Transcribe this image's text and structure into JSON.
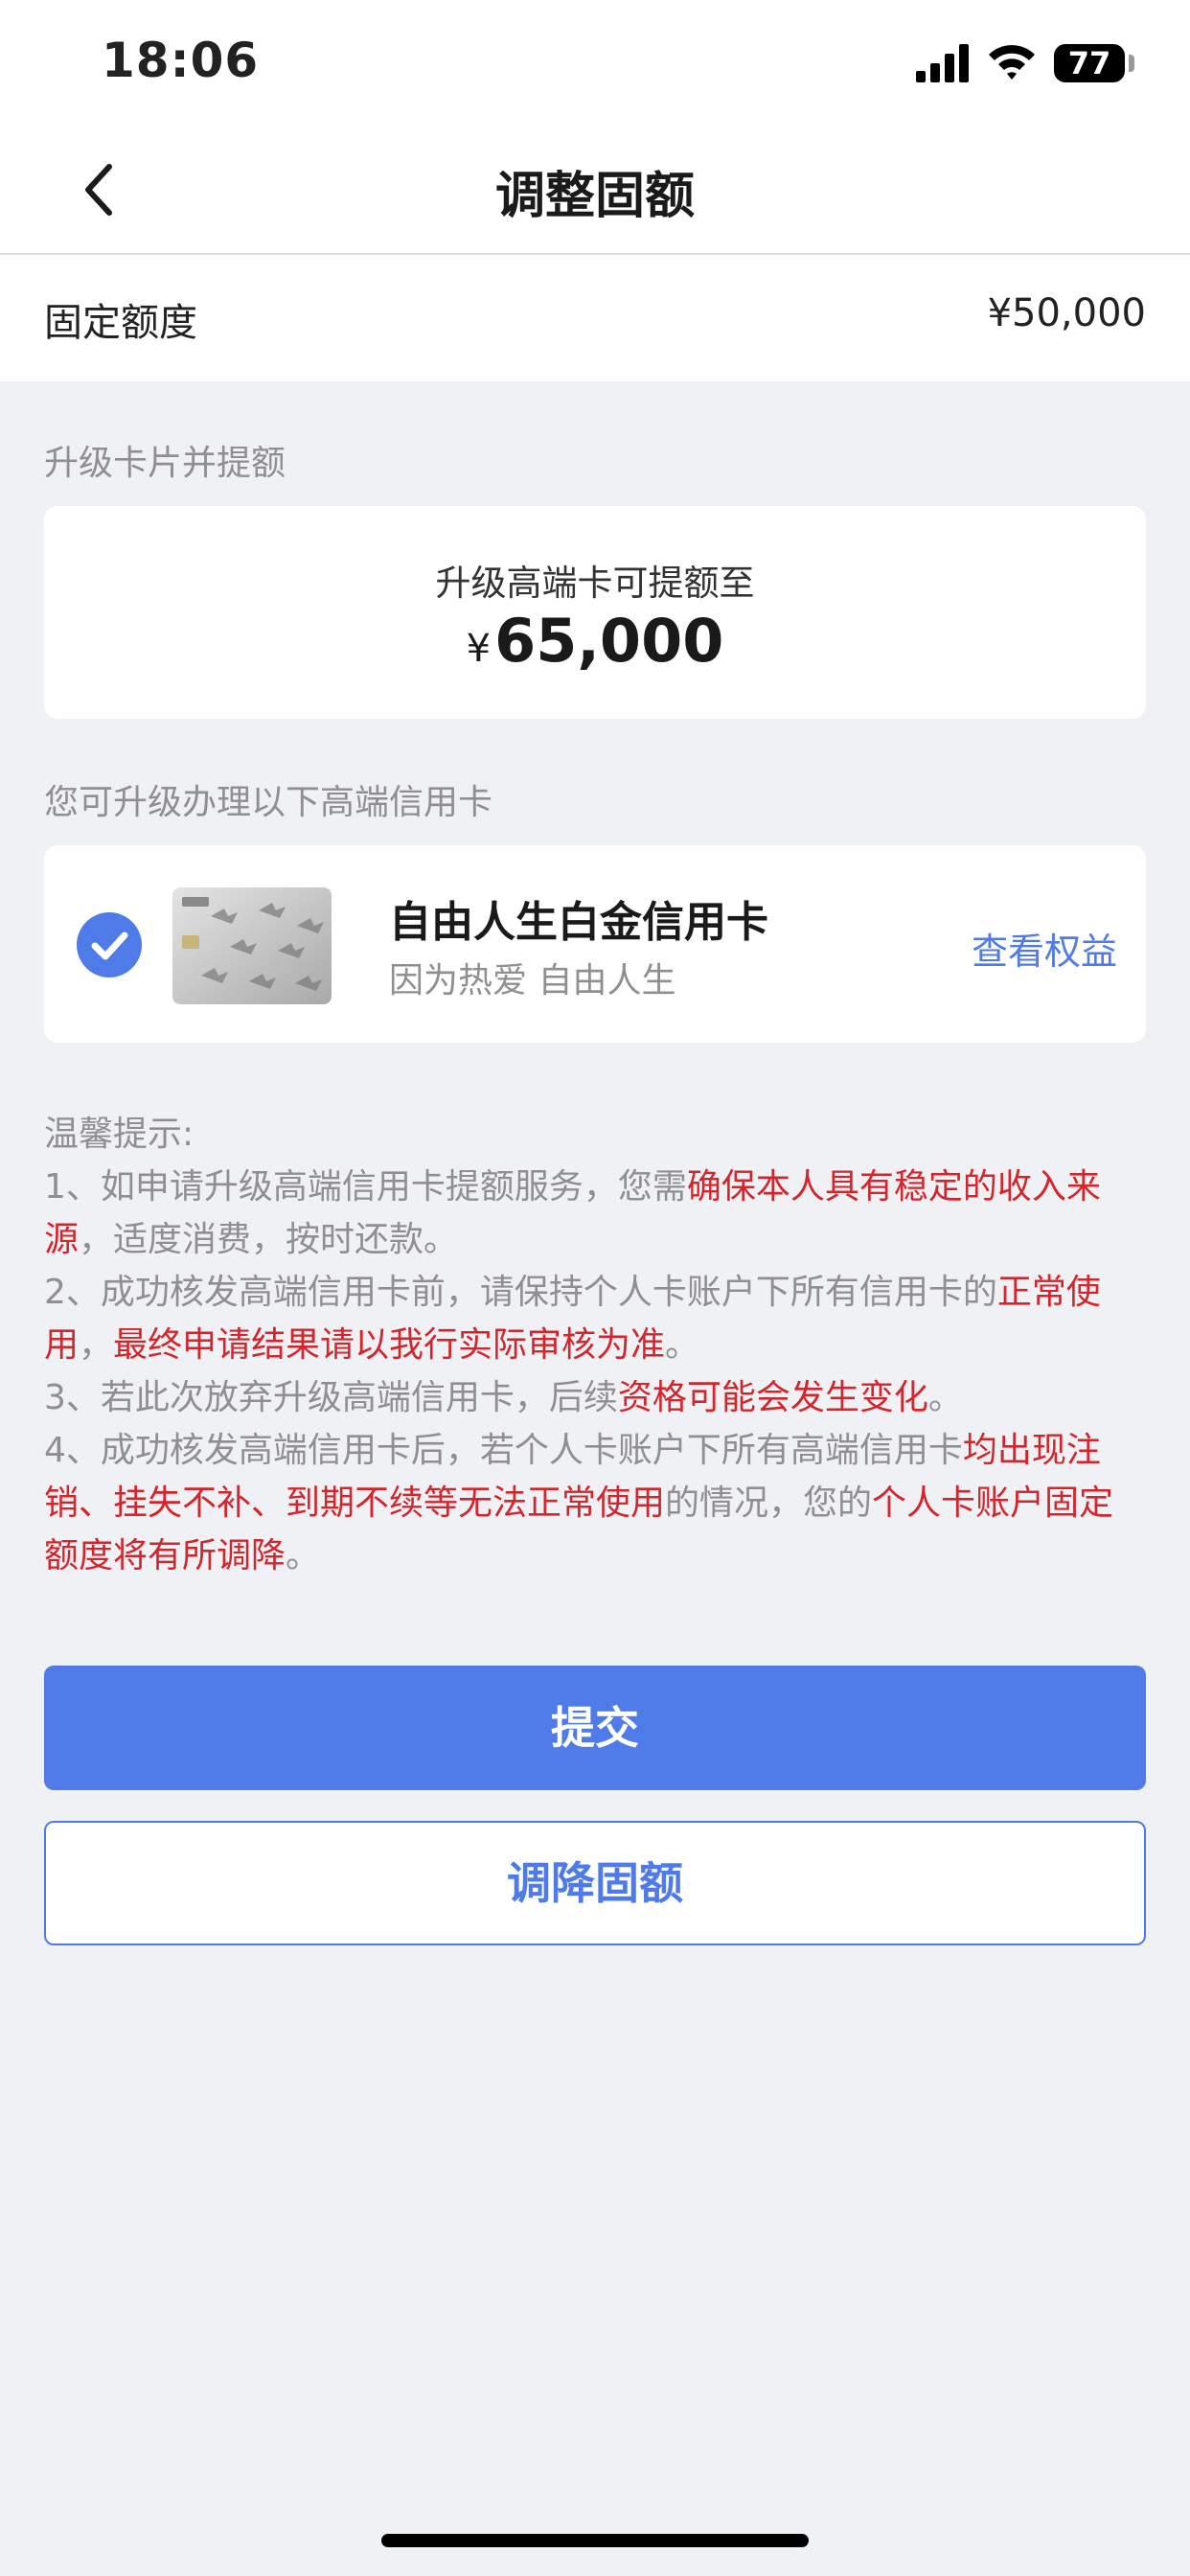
{
  "status_bar": {
    "time": "18:06",
    "battery": "77",
    "icons": [
      "signal-icon",
      "wifi-icon",
      "battery-icon"
    ]
  },
  "nav": {
    "title": "调整固额",
    "back_icon": "chevron-left-icon"
  },
  "fixed_limit": {
    "label": "固定额度",
    "value": "¥50,000"
  },
  "upgrade_section": {
    "label": "升级卡片并提额",
    "sub": "升级高端卡可提额至",
    "currency": "¥",
    "amount": "65,000"
  },
  "card_section": {
    "label": "您可升级办理以下高端信用卡",
    "card": {
      "name": "自由人生白金信用卡",
      "slogan": "因为热爱 自由人生",
      "link": "查看权益",
      "selected": true
    }
  },
  "tips": {
    "title": "温馨提示:",
    "items": [
      [
        {
          "text": "1、如申请升级高端信用卡提额服务，您需",
          "highlight": false
        },
        {
          "text": "确保本人具有稳定的收入来源",
          "highlight": true
        },
        {
          "text": "，适度消费，按时还款。",
          "highlight": false
        }
      ],
      [
        {
          "text": "2、成功核发高端信用卡前，请保持个人卡账户下所有信用卡的",
          "highlight": false
        },
        {
          "text": "正常使用",
          "highlight": true
        },
        {
          "text": "，",
          "highlight": false
        },
        {
          "text": "最终申请结果请以我行实际审核为准",
          "highlight": true
        },
        {
          "text": "。",
          "highlight": false
        }
      ],
      [
        {
          "text": "3、若此次放弃升级高端信用卡，后续",
          "highlight": false
        },
        {
          "text": "资格可能会发生变化",
          "highlight": true
        },
        {
          "text": "。",
          "highlight": false
        }
      ],
      [
        {
          "text": "4、成功核发高端信用卡后，若个人卡账户下所有高端信用卡",
          "highlight": false
        },
        {
          "text": "均出现注销、挂失不补、到期不续等无法正常使用",
          "highlight": true
        },
        {
          "text": "的情况，您的",
          "highlight": false
        },
        {
          "text": "个人卡账户固定额度将有所调降",
          "highlight": true
        },
        {
          "text": "。",
          "highlight": false
        }
      ]
    ]
  },
  "buttons": {
    "submit": "提交",
    "lower": "调降固额"
  },
  "colors": {
    "accent": "#4f7be8",
    "highlight": "#d3262c",
    "background": "#f0f1f5"
  }
}
